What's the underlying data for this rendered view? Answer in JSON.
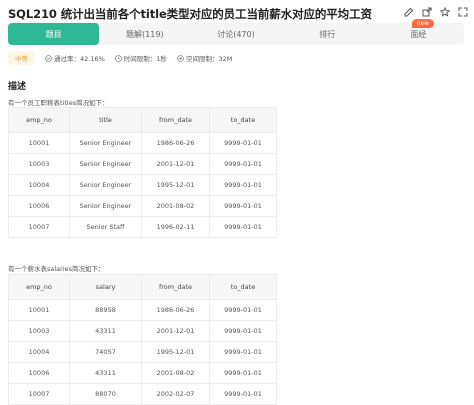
{
  "problem": {
    "title": "SQL210  统计出当前各个title类型对应的员工当前薪水对应的平均工资",
    "icons": [
      "edit-icon",
      "share-icon",
      "star-icon",
      "expand-icon"
    ]
  },
  "tabs": [
    {
      "label": "题目",
      "active": true
    },
    {
      "label": "题解(119)",
      "active": false
    },
    {
      "label": "讨论(470)",
      "active": false
    },
    {
      "label": "排行",
      "active": false
    },
    {
      "label": "面经",
      "active": false,
      "badge": "new"
    }
  ],
  "meta": {
    "difficulty": "中等",
    "pass_rate": "通过率：42.16%",
    "time_limit": "时间限制：1秒",
    "space_limit": "空间限制：32M"
  },
  "description": {
    "heading": "描述",
    "titles_caption": "有一个员工职称表titles简况如下：",
    "salaries_caption": "有一个薪水表salaries简况如下："
  },
  "titles_table": {
    "headers": [
      "emp_no",
      "title",
      "from_date",
      "to_date"
    ],
    "rows": [
      [
        "10001",
        "Senior Engineer",
        "1986-06-26",
        "9999-01-01"
      ],
      [
        "10003",
        "Senior Engineer",
        "2001-12-01",
        "9999-01-01"
      ],
      [
        "10004",
        "Senior Engineer",
        "1995-12-01",
        "9999-01-01"
      ],
      [
        "10006",
        "Senior Engineer",
        "2001-08-02",
        "9999-01-01"
      ],
      [
        "10007",
        "Senior Staff",
        "1996-02-11",
        "9999-01-01"
      ]
    ]
  },
  "salaries_table": {
    "headers": [
      "emp_no",
      "salary",
      "from_date",
      "to_date"
    ],
    "rows": [
      [
        "10001",
        "88958",
        "1986-06-26",
        "9999-01-01"
      ],
      [
        "10003",
        "43311",
        "2001-12-01",
        "9999-01-01"
      ],
      [
        "10004",
        "74057",
        "1995-12-01",
        "9999-01-01"
      ],
      [
        "10006",
        "43311",
        "2001-08-02",
        "9999-01-01"
      ],
      [
        "10007",
        "88070",
        "2002-02-07",
        "9999-01-01"
      ]
    ]
  },
  "colors": {
    "accent": "#2fb895",
    "badge": "#ff6a3d",
    "difficulty": "#f0a020"
  }
}
